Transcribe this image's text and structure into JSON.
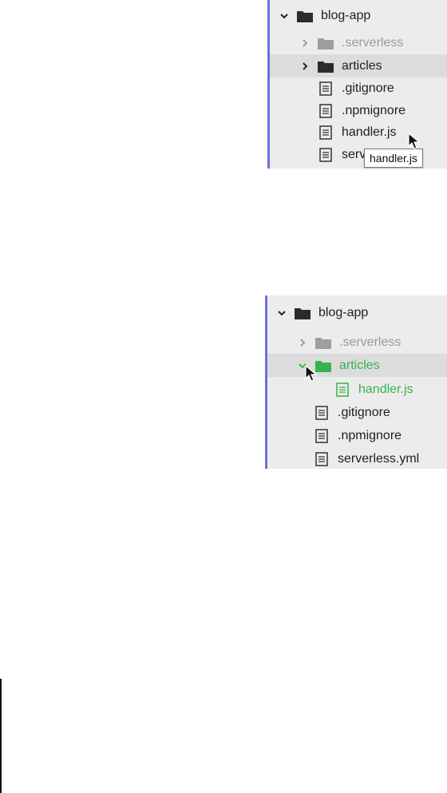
{
  "tree_top": {
    "root": "blog-app",
    "items": [
      {
        "label": ".serverless"
      },
      {
        "label": "articles"
      },
      {
        "label": ".gitignore"
      },
      {
        "label": ".npmignore"
      },
      {
        "label": "handler.js"
      },
      {
        "label": "serv"
      }
    ],
    "tooltip": "handler.js"
  },
  "tree_bottom": {
    "root": "blog-app",
    "items": [
      {
        "label": ".serverless"
      },
      {
        "label": "articles"
      },
      {
        "label": "handler.js"
      },
      {
        "label": ".gitignore"
      },
      {
        "label": ".npmignore"
      },
      {
        "label": "serverless.yml"
      }
    ]
  },
  "colors": {
    "accent_border": "#6b72d9",
    "panel_bg": "#ececec",
    "selected_bg": "#dcdcdc",
    "muted_text": "#9a9a9a",
    "new_item_green": "#37b24d"
  },
  "icons": {
    "expanded": "chevron-down-icon",
    "collapsed": "chevron-right-icon",
    "folder": "folder-icon",
    "file": "file-icon",
    "pointer": "mouse-cursor-icon"
  }
}
